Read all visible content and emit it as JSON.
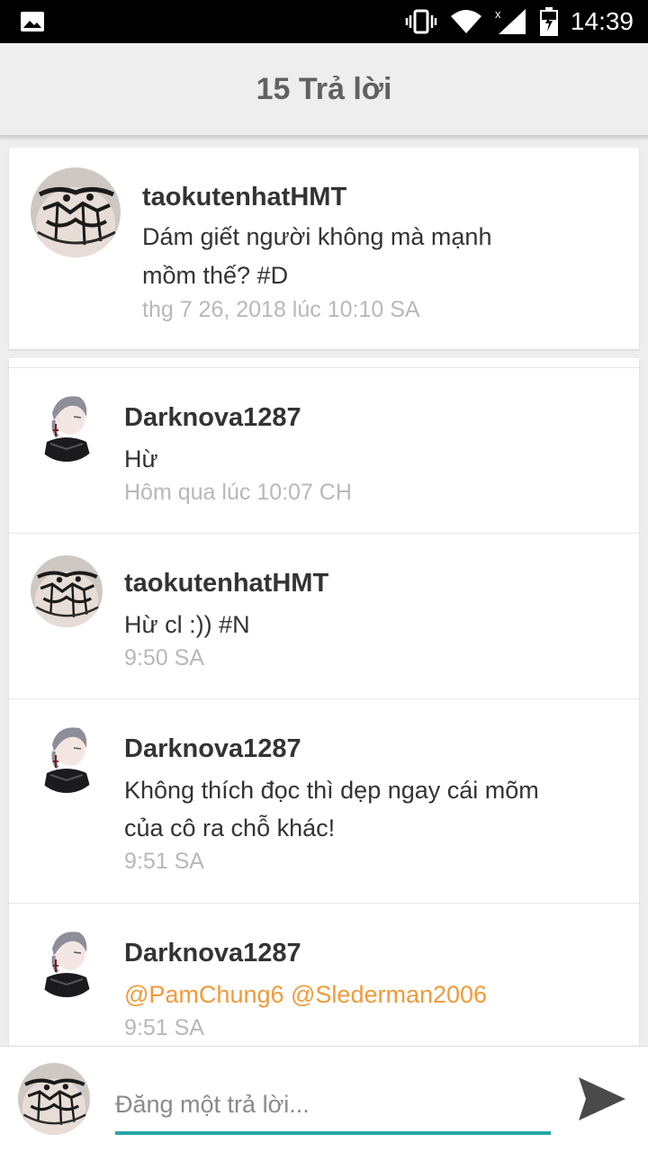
{
  "status_bar": {
    "time": "14:39",
    "icons": [
      "image-icon",
      "vibrate-icon",
      "wifi-icon",
      "signal-icon",
      "battery-icon"
    ]
  },
  "header": {
    "title": "15 Trả lời"
  },
  "post": {
    "avatar": "lace-avatar",
    "username": "taokutenhatHMT",
    "message_line1": "Dám giết người không mà mạnh",
    "message_line2": "mồm thế? #D",
    "timestamp": "thg 7 26, 2018 lúc 10:10 SA"
  },
  "replies": [
    {
      "avatar": "anime-boy-avatar",
      "username": "Darknova1287",
      "message_line1": "Hừ",
      "message_line2": "",
      "timestamp": "Hôm qua lúc 10:07 CH"
    },
    {
      "avatar": "lace-avatar",
      "username": "taokutenhatHMT",
      "message_line1": "Hừ cl :)) #N",
      "message_line2": "",
      "timestamp": "9:50 SA"
    },
    {
      "avatar": "anime-boy-avatar",
      "username": "Darknova1287",
      "message_line1": "Không thích đọc thì dẹp ngay cái mõm",
      "message_line2": "của cô ra chỗ khác!",
      "timestamp": "9:51 SA"
    },
    {
      "avatar": "anime-boy-avatar",
      "username": "Darknova1287",
      "mentions": "@PamChung6 @Slederman2006",
      "timestamp": "9:51 SA"
    }
  ],
  "compose": {
    "placeholder": "Đăng một trả lời..."
  },
  "colors": {
    "accent": "#26a5a7",
    "mention": "#f29a3a",
    "timestamp": "#b8b8b8",
    "title": "#616161"
  }
}
